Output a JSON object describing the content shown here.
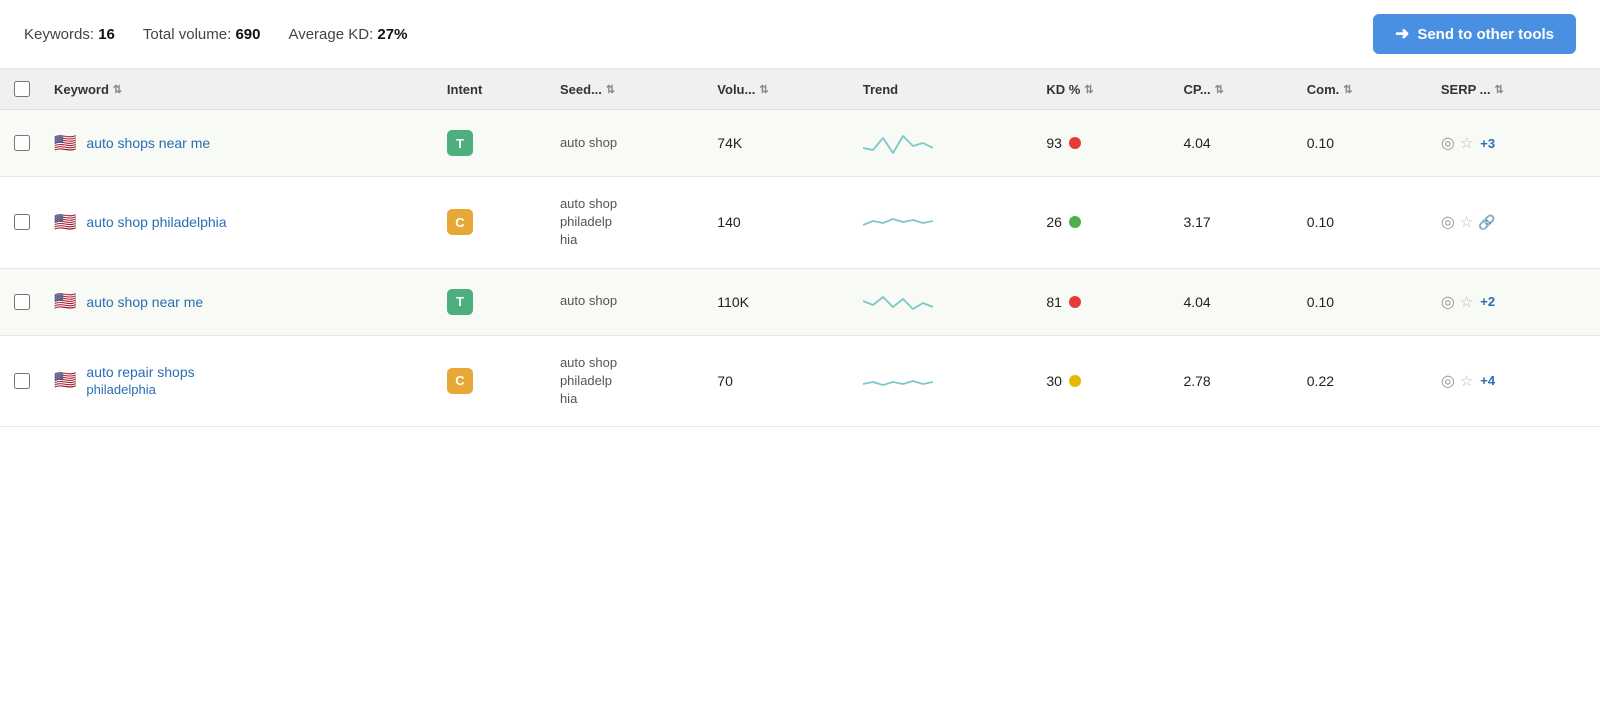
{
  "topbar": {
    "keywords_label": "Keywords:",
    "keywords_count": "16",
    "volume_label": "Total volume:",
    "volume_value": "690",
    "kd_label": "Average KD:",
    "kd_value": "27%",
    "send_button_label": "Send to other tools"
  },
  "table": {
    "columns": [
      {
        "id": "checkbox",
        "label": ""
      },
      {
        "id": "keyword",
        "label": "Keyword"
      },
      {
        "id": "intent",
        "label": "Intent"
      },
      {
        "id": "seed",
        "label": "Seed..."
      },
      {
        "id": "volume",
        "label": "Volu..."
      },
      {
        "id": "trend",
        "label": "Trend"
      },
      {
        "id": "kd",
        "label": "KD %"
      },
      {
        "id": "cp",
        "label": "CP..."
      },
      {
        "id": "com",
        "label": "Com."
      },
      {
        "id": "serp",
        "label": "SERP ..."
      }
    ],
    "rows": [
      {
        "id": 1,
        "flag": "🇺🇸",
        "keyword": "auto shops near me",
        "keyword_sub": "",
        "intent": "T",
        "intent_type": "t",
        "seed": "auto shop",
        "volume": "74K",
        "kd": "93",
        "kd_color": "red",
        "cp": "4.04",
        "com": "0.10",
        "serp_plus": "+3"
      },
      {
        "id": 2,
        "flag": "🇺🇸",
        "keyword": "auto shop philadelphia",
        "keyword_sub": "",
        "intent": "C",
        "intent_type": "c",
        "seed": "auto shop philadelp hia",
        "volume": "140",
        "kd": "26",
        "kd_color": "green",
        "cp": "3.17",
        "com": "0.10",
        "serp_plus": ""
      },
      {
        "id": 3,
        "flag": "🇺🇸",
        "keyword": "auto shop near me",
        "keyword_sub": "",
        "intent": "T",
        "intent_type": "t",
        "seed": "auto shop",
        "volume": "110K",
        "kd": "81",
        "kd_color": "red",
        "cp": "4.04",
        "com": "0.10",
        "serp_plus": "+2"
      },
      {
        "id": 4,
        "flag": "🇺🇸",
        "keyword": "auto repair shops",
        "keyword_sub": "philadelphia",
        "intent": "C",
        "intent_type": "c",
        "seed": "auto shop philadelp hia",
        "volume": "70",
        "kd": "30",
        "kd_color": "yellow",
        "cp": "2.78",
        "com": "0.22",
        "serp_plus": "+4"
      }
    ]
  }
}
